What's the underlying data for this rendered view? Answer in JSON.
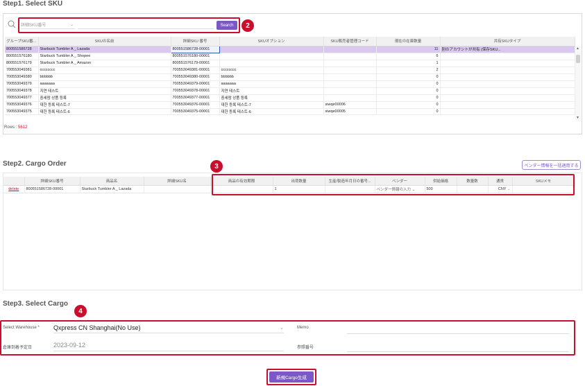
{
  "step1": {
    "title": "Step1. Select SKU",
    "search_type": "詳細SKU番号",
    "search_placeholder": "",
    "search_button": "Search",
    "headers": [
      "グループSKU番...",
      "SKUの名前",
      "詳細SKU 番号",
      "SKUオプション",
      "SKU販売者管理コード",
      "現在の在庫数量",
      "共有SKUタイプ"
    ],
    "rows": [
      [
        "800551586728",
        "Starbuck Tumbler A _ Lazada",
        "800551586728-00001",
        "",
        "",
        "11",
        "別のアカウントが共有 (保存SKU..."
      ],
      [
        "800551576180",
        "Starbuck Tumbler A _ Shopee",
        "800551576180-00001",
        "",
        "",
        "6",
        ""
      ],
      [
        "800551576179",
        "Starbuck Tumbler A _ Amazon",
        "800551576179-00001",
        "",
        "",
        "1",
        ""
      ],
      [
        "700553049381",
        "cccccccc",
        "700553049381-00001",
        "cccccccc",
        "",
        "2",
        ""
      ],
      [
        "700553049380",
        "bbbbbb",
        "700553049380-00001",
        "bbbbbb",
        "",
        "0",
        ""
      ],
      [
        "700553049379",
        "aaaaaaa",
        "700553049379-00001",
        "aaaaaaa",
        "",
        "0",
        ""
      ],
      [
        "700553049378",
        "지연 테스트",
        "700553049378-00001",
        "지연 테스트",
        "",
        "0",
        ""
      ],
      [
        "700553049377",
        "중세람 상품 등록",
        "700553049377-00001",
        "중세람 상품 등록",
        "",
        "0",
        ""
      ],
      [
        "700553049376",
        "대한 등록 테스트-7",
        "700553049376-00001",
        "대한 등록 테스트-7",
        "siwqe00006",
        "0",
        ""
      ],
      [
        "700553049375",
        "대한 등록 테스트-6",
        "700553049375-00001",
        "대한 등록 테스트-6",
        "siwqe00005",
        "0",
        ""
      ]
    ],
    "rows_label": "Rows :",
    "rows_count": "5612",
    "badge": "2"
  },
  "step2": {
    "title": "Step2. Cargo Order",
    "vendor_button": "ベンダー情報を一括適用する",
    "headers": [
      "",
      "詳細SKU番号",
      "商品名",
      "詳細SKU名",
      "商品の有効期限",
      "出荷数量",
      "生産/製造年月日の番号...",
      "ベンダー",
      "供給価格",
      "数量数",
      "通貨",
      "SKUメモ"
    ],
    "row": {
      "action": "delete",
      "sku": "800551586728-00001",
      "name": "Starbuck Tumbler A _ Lazada",
      "sku_name": "",
      "expiry": "",
      "qty": "1",
      "lot": "",
      "vendor": "ベンダー情報の入力",
      "price": "500",
      "count": "",
      "currency": "CNY",
      "memo": ""
    },
    "badge": "3"
  },
  "step3": {
    "title": "Step3. Select Cargo",
    "warehouse_label": "Select Warehouse *",
    "warehouse_value": "Qxpress CN Shanghai(No Use)",
    "memo_label": "Memo",
    "arrival_label": "倉庫到着予定日",
    "arrival_value": "2023-09-12",
    "ref_label": "参照番号",
    "badge": "4"
  },
  "submit_button": "新規Cargo生成",
  "colors": {
    "accent": "#7b58c6",
    "highlight": "#c8102e",
    "selected_row": "#d9c8ef"
  }
}
